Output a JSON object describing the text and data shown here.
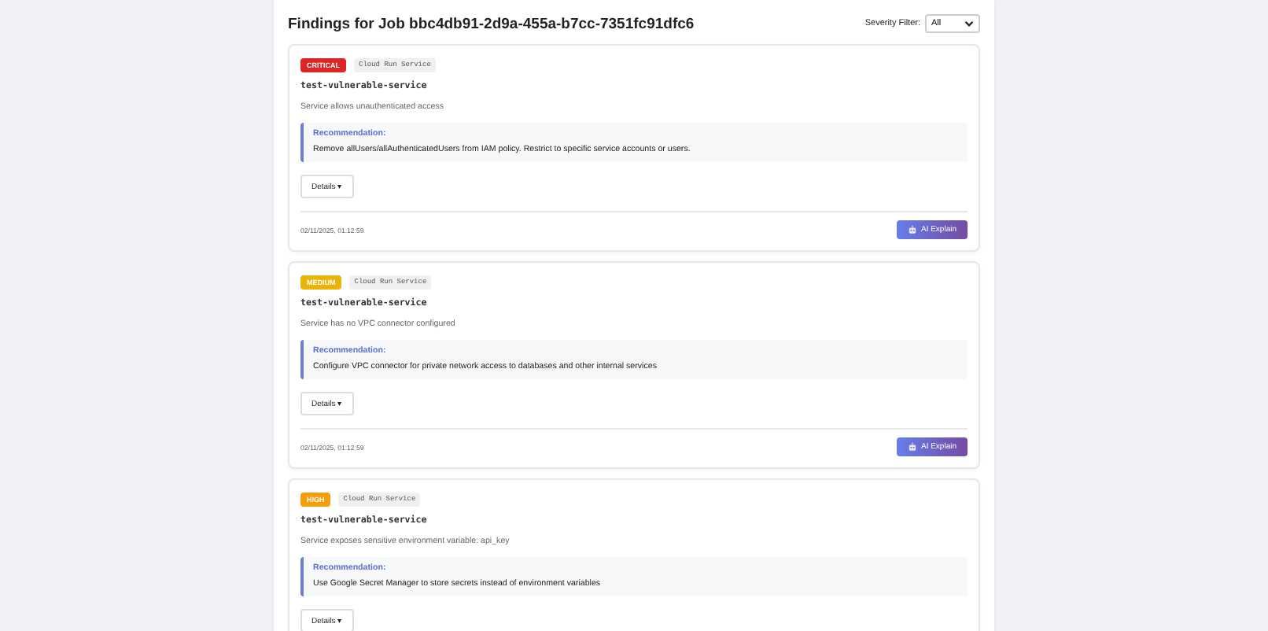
{
  "header": {
    "title": "Findings for Job bbc4db91-2d9a-455a-b7cc-7351fc91dfc6",
    "filter": {
      "label": "Severity Filter:",
      "value": "All"
    }
  },
  "findings": [
    {
      "severity": {
        "label": "CRITICAL",
        "kind": "critical"
      },
      "resource_type": "Cloud Run Service",
      "resource": "test-vulnerable-service",
      "description": "Service allows unauthenticated access",
      "recommendation": {
        "title": "Recommendation:",
        "text": "Remove allUsers/allAuthenticatedUsers from IAM policy. Restrict to specific service accounts or users."
      },
      "details": "Details ▾",
      "timestamp": "02/11/2025, 01:12:59",
      "action": "AI Explain"
    },
    {
      "severity": {
        "label": "MEDIUM",
        "kind": "medium"
      },
      "resource_type": "Cloud Run Service",
      "resource": "test-vulnerable-service",
      "description": "Service has no VPC connector configured",
      "recommendation": {
        "title": "Recommendation:",
        "text": "Configure VPC connector for private network access to databases and other internal services"
      },
      "details": "Details ▾",
      "timestamp": "02/11/2025, 01:12:59",
      "action": "AI Explain"
    },
    {
      "severity": {
        "label": "HIGH",
        "kind": "high"
      },
      "resource_type": "Cloud Run Service",
      "resource": "test-vulnerable-service",
      "description": "Service exposes sensitive environment variable: api_key",
      "recommendation": {
        "title": "Recommendation:",
        "text": "Use Google Secret Manager to store secrets instead of environment variables"
      },
      "details": "Details ▾"
    }
  ]
}
